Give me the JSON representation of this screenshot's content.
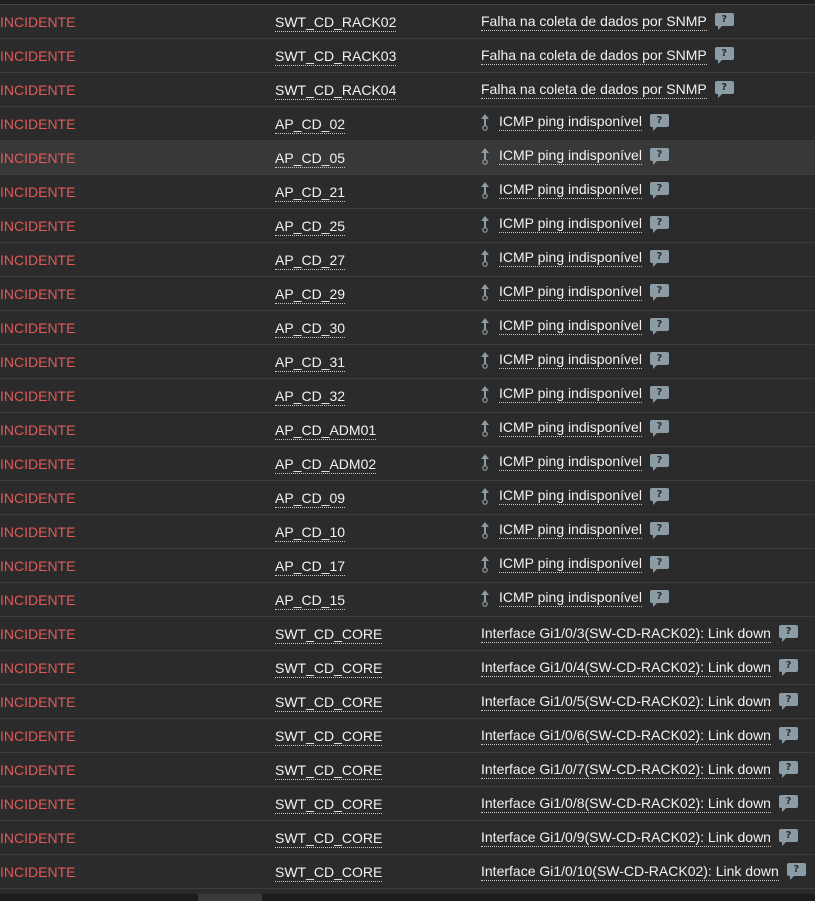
{
  "problems": {
    "rows": [
      {
        "status": "INCIDENTE",
        "host": "SWT_CD_RACK02",
        "problem": "Falha na coleta de dados por SNMP",
        "dependency": false
      },
      {
        "status": "INCIDENTE",
        "host": "SWT_CD_RACK03",
        "problem": "Falha na coleta de dados por SNMP",
        "dependency": false
      },
      {
        "status": "INCIDENTE",
        "host": "SWT_CD_RACK04",
        "problem": "Falha na coleta de dados por SNMP",
        "dependency": false
      },
      {
        "status": "INCIDENTE",
        "host": "AP_CD_02",
        "problem": "ICMP ping indisponível",
        "dependency": true
      },
      {
        "status": "INCIDENTE",
        "host": "AP_CD_05",
        "problem": "ICMP ping indisponível",
        "dependency": true
      },
      {
        "status": "INCIDENTE",
        "host": "AP_CD_21",
        "problem": "ICMP ping indisponível",
        "dependency": true
      },
      {
        "status": "INCIDENTE",
        "host": "AP_CD_25",
        "problem": "ICMP ping indisponível",
        "dependency": true
      },
      {
        "status": "INCIDENTE",
        "host": "AP_CD_27",
        "problem": "ICMP ping indisponível",
        "dependency": true
      },
      {
        "status": "INCIDENTE",
        "host": "AP_CD_29",
        "problem": "ICMP ping indisponível",
        "dependency": true
      },
      {
        "status": "INCIDENTE",
        "host": "AP_CD_30",
        "problem": "ICMP ping indisponível",
        "dependency": true
      },
      {
        "status": "INCIDENTE",
        "host": "AP_CD_31",
        "problem": "ICMP ping indisponível",
        "dependency": true
      },
      {
        "status": "INCIDENTE",
        "host": "AP_CD_32",
        "problem": "ICMP ping indisponível",
        "dependency": true
      },
      {
        "status": "INCIDENTE",
        "host": "AP_CD_ADM01",
        "problem": "ICMP ping indisponível",
        "dependency": true
      },
      {
        "status": "INCIDENTE",
        "host": "AP_CD_ADM02",
        "problem": "ICMP ping indisponível",
        "dependency": true
      },
      {
        "status": "INCIDENTE",
        "host": "AP_CD_09",
        "problem": "ICMP ping indisponível",
        "dependency": true
      },
      {
        "status": "INCIDENTE",
        "host": "AP_CD_10",
        "problem": "ICMP ping indisponível",
        "dependency": true
      },
      {
        "status": "INCIDENTE",
        "host": "AP_CD_17",
        "problem": "ICMP ping indisponível",
        "dependency": true
      },
      {
        "status": "INCIDENTE",
        "host": "AP_CD_15",
        "problem": "ICMP ping indisponível",
        "dependency": true
      },
      {
        "status": "INCIDENTE",
        "host": "SWT_CD_CORE",
        "problem": "Interface Gi1/0/3(SW-CD-RACK02): Link down",
        "dependency": false
      },
      {
        "status": "INCIDENTE",
        "host": "SWT_CD_CORE",
        "problem": "Interface Gi1/0/4(SW-CD-RACK02): Link down",
        "dependency": false
      },
      {
        "status": "INCIDENTE",
        "host": "SWT_CD_CORE",
        "problem": "Interface Gi1/0/5(SW-CD-RACK02): Link down",
        "dependency": false
      },
      {
        "status": "INCIDENTE",
        "host": "SWT_CD_CORE",
        "problem": "Interface Gi1/0/6(SW-CD-RACK02): Link down",
        "dependency": false
      },
      {
        "status": "INCIDENTE",
        "host": "SWT_CD_CORE",
        "problem": "Interface Gi1/0/7(SW-CD-RACK02): Link down",
        "dependency": false
      },
      {
        "status": "INCIDENTE",
        "host": "SWT_CD_CORE",
        "problem": "Interface Gi1/0/8(SW-CD-RACK02): Link down",
        "dependency": false
      },
      {
        "status": "INCIDENTE",
        "host": "SWT_CD_CORE",
        "problem": "Interface Gi1/0/9(SW-CD-RACK02): Link down",
        "dependency": false
      },
      {
        "status": "INCIDENTE",
        "host": "SWT_CD_CORE",
        "problem": "Interface Gi1/0/10(SW-CD-RACK02): Link down",
        "dependency": false
      }
    ],
    "help_icon_text": "?",
    "icons": {
      "dependency": "dependency-arrow-icon",
      "help": "help-comment-icon"
    }
  },
  "colors": {
    "background": "#2b2b2b",
    "status": "#e45959",
    "text": "#f2f2f2",
    "help_icon": "#8c9ca6"
  }
}
